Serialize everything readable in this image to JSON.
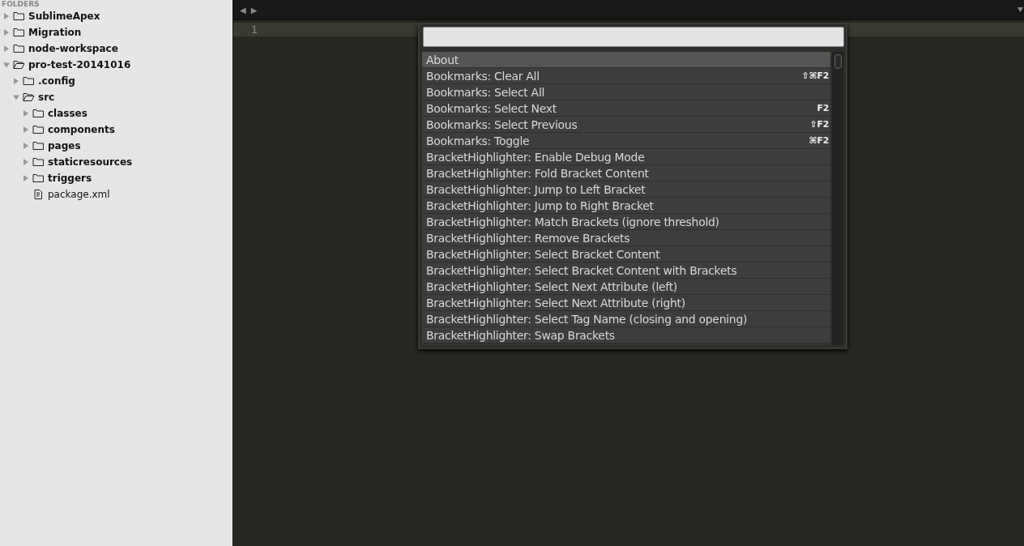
{
  "sidebar": {
    "header": "FOLDERS",
    "tree": [
      {
        "kind": "folder",
        "label": "SublimeApex",
        "expanded": false
      },
      {
        "kind": "folder",
        "label": "Migration",
        "expanded": false
      },
      {
        "kind": "folder",
        "label": "node-workspace",
        "expanded": false
      },
      {
        "kind": "folder",
        "label": "pro-test-20141016",
        "expanded": true,
        "children": [
          {
            "kind": "folder",
            "label": ".config",
            "expanded": false
          },
          {
            "kind": "folder",
            "label": "src",
            "expanded": true,
            "children": [
              {
                "kind": "folder",
                "label": "classes",
                "expanded": false
              },
              {
                "kind": "folder",
                "label": "components",
                "expanded": false
              },
              {
                "kind": "folder",
                "label": "pages",
                "expanded": false
              },
              {
                "kind": "folder",
                "label": "staticresources",
                "expanded": false
              },
              {
                "kind": "folder",
                "label": "triggers",
                "expanded": false
              },
              {
                "kind": "file",
                "label": "package.xml"
              }
            ]
          }
        ]
      }
    ]
  },
  "tab_bar": {
    "back": "◀",
    "forward": "▶"
  },
  "editor": {
    "line_numbers": [
      "1"
    ]
  },
  "command_palette": {
    "items": [
      {
        "label": "About",
        "selected": true
      },
      {
        "label": "Bookmarks: Clear All",
        "shortcut": "⇧⌘F2",
        "selected": false
      },
      {
        "label": "Bookmarks: Select All",
        "selected": false
      },
      {
        "label": "Bookmarks: Select Next",
        "shortcut": "F2",
        "selected": false
      },
      {
        "label": "Bookmarks: Select Previous",
        "shortcut": "⇧F2",
        "selected": false
      },
      {
        "label": "Bookmarks: Toggle",
        "shortcut": "⌘F2",
        "selected": false
      },
      {
        "label": "BracketHighlighter: Enable Debug Mode",
        "selected": false
      },
      {
        "label": "BracketHighlighter: Fold Bracket Content",
        "selected": false
      },
      {
        "label": "BracketHighlighter: Jump to Left Bracket",
        "selected": false
      },
      {
        "label": "BracketHighlighter: Jump to Right Bracket",
        "selected": false
      },
      {
        "label": "BracketHighlighter: Match Brackets (ignore threshold)",
        "selected": false
      },
      {
        "label": "BracketHighlighter: Remove Brackets",
        "selected": false
      },
      {
        "label": "BracketHighlighter: Select Bracket Content",
        "selected": false
      },
      {
        "label": "BracketHighlighter: Select Bracket Content with Brackets",
        "selected": false
      },
      {
        "label": "BracketHighlighter: Select Next Attribute (left)",
        "selected": false
      },
      {
        "label": "BracketHighlighter: Select Next Attribute (right)",
        "selected": false
      },
      {
        "label": "BracketHighlighter: Select Tag Name (closing and opening)",
        "selected": false
      },
      {
        "label": "BracketHighlighter: Swap Brackets",
        "selected": false
      }
    ]
  }
}
